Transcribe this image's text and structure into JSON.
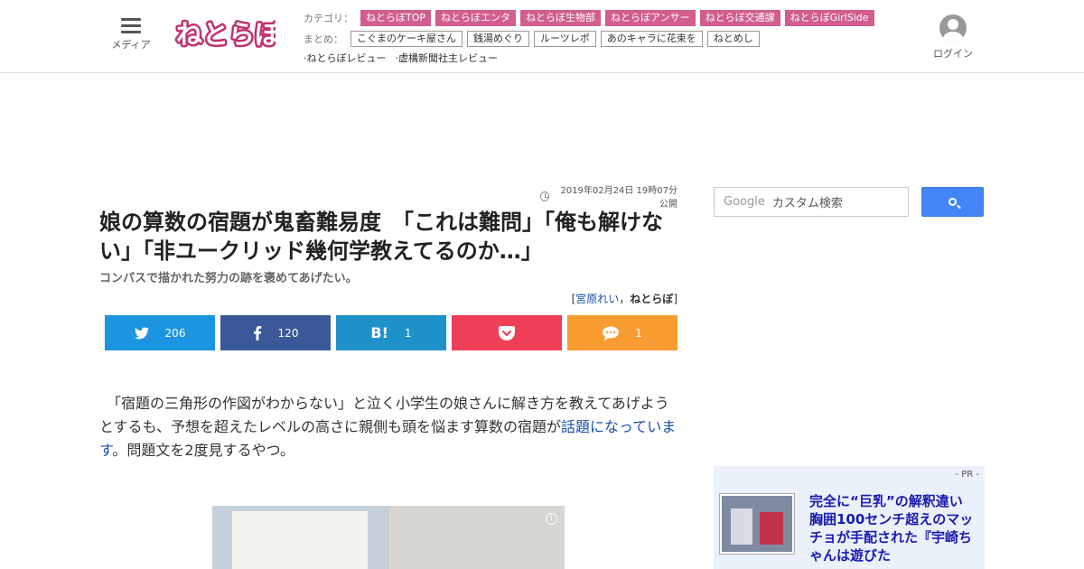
{
  "header": {
    "menu_label": "メディア",
    "logo_text": "ねとらぼ",
    "category_label": "カテゴリ：",
    "categories": [
      "ねとらぼTOP",
      "ねとらぼエンタ",
      "ねとらぼ生物部",
      "ねとらぼアンサー",
      "ねとらぼ交通課",
      "ねとらぼGirlSide"
    ],
    "matome_label": "まとめ：",
    "matome": [
      "こぐまのケーキ屋さん",
      "銭湯めぐり",
      "ルーツレポ",
      "あのキャラに花束を",
      "ねとめし"
    ],
    "reviews": [
      "·ねとらぼレビュー",
      "·虚構新聞社主レビュー"
    ],
    "login_label": "ログイン"
  },
  "article": {
    "date": "2019年02月24日 19時07分 公開",
    "title": "娘の算数の宿題が鬼畜難易度　「これは難問」「俺も解けない」「非ユークリッド幾何学教えてるのか…」",
    "subtitle": "コンパスで描かれた努力の跡を褒めてあげたい。",
    "author_open": "[",
    "author_name": "宮原れい",
    "author_sep": "，",
    "author_site": "ねとらぼ",
    "author_close": "]",
    "body_before": "　「宿題の三角形の作図がわからない」と泣く小学生の娘さんに解き方を教えてあげようとするも、予想を超えたレベルの高さに親側も頭を悩ます算数の宿題が",
    "body_link": "話題になっています",
    "body_after": "。問題文を2度見するやつ。"
  },
  "share": {
    "twitter_count": "206",
    "facebook_count": "120",
    "hatena_count": "1",
    "hatena_icon": "B!",
    "comment_count": "1"
  },
  "sidebar": {
    "search_brand": "Google",
    "search_placeholder": "カスタム検索",
    "pr_label": "- PR -",
    "pr_title": "完全に“巨乳”の解釈違い　胸囲100センチ超えのマッチョが手配された『宇崎ちゃんは遊びた"
  },
  "colors": {
    "tag_pink": "#d15e8f",
    "twitter": "#1b95e0",
    "facebook": "#3b5998",
    "hatena": "#1d92c9",
    "pocket": "#ef3f56",
    "comment": "#f89b31",
    "search_button": "#4485f5",
    "link": "#1a4db0"
  }
}
